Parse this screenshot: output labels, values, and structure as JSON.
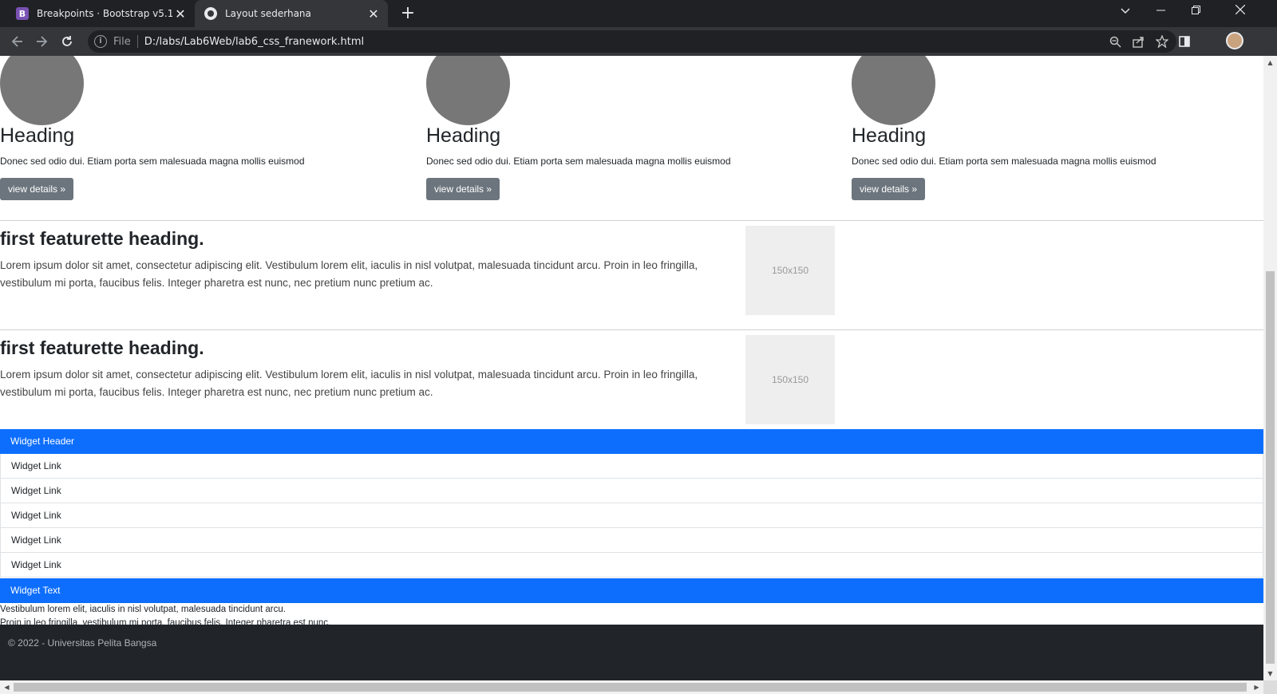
{
  "browser": {
    "tabs": [
      {
        "title": "Breakpoints · Bootstrap v5.1",
        "favicon": "bootstrap-icon",
        "active": false
      },
      {
        "title": "Layout sederhana",
        "favicon": "globe-icon",
        "active": true
      }
    ],
    "favicon_letter": "B",
    "close_glyph": "✕",
    "new_tab_glyph": "+",
    "scheme_label": "File",
    "info_glyph": "i",
    "url": "D:/labs/Lab6Web/lab6_css_franework.html",
    "accent": "#0d6efd"
  },
  "marketing": [
    {
      "heading": "Heading",
      "text": "Donec sed odio dui. Etiam porta sem malesuada magna mollis euismod",
      "button": "view details »"
    },
    {
      "heading": "Heading",
      "text": "Donec sed odio dui. Etiam porta sem malesuada magna mollis euismod",
      "button": "view details »"
    },
    {
      "heading": "Heading",
      "text": "Donec sed odio dui. Etiam porta sem malesuada magna mollis euismod",
      "button": "view details »"
    }
  ],
  "featurettes": [
    {
      "heading": "first featurette heading.",
      "text": "Lorem ipsum dolor sit amet, consectetur adipiscing elit. Vestibulum lorem elit, iaculis in nisl volutpat, malesuada tincidunt arcu. Proin in leo fringilla, vestibulum mi porta, faucibus felis. Integer pharetra est nunc, nec pretium nunc pretium ac.",
      "image_label": "150x150"
    },
    {
      "heading": "first featurette heading.",
      "text": "Lorem ipsum dolor sit amet, consectetur adipiscing elit. Vestibulum lorem elit, iaculis in nisl volutpat, malesuada tincidunt arcu. Proin in leo fringilla, vestibulum mi porta, faucibus felis. Integer pharetra est nunc, nec pretium nunc pretium ac.",
      "image_label": "150x150"
    }
  ],
  "widget": {
    "header": "Widget Header",
    "links": [
      "Widget Link",
      "Widget Link",
      "Widget Link",
      "Widget Link",
      "Widget Link"
    ],
    "text_header": "Widget Text",
    "text_lines": [
      "Vestibulum lorem elit, iaculis in nisl volutpat, malesuada tincidunt arcu.",
      "Proin in leo fringilla, vestibulum mi porta, faucibus felis. Integer pharetra est nunc,"
    ]
  },
  "footer": {
    "text": "© 2022 - Universitas Pelita Bangsa"
  }
}
